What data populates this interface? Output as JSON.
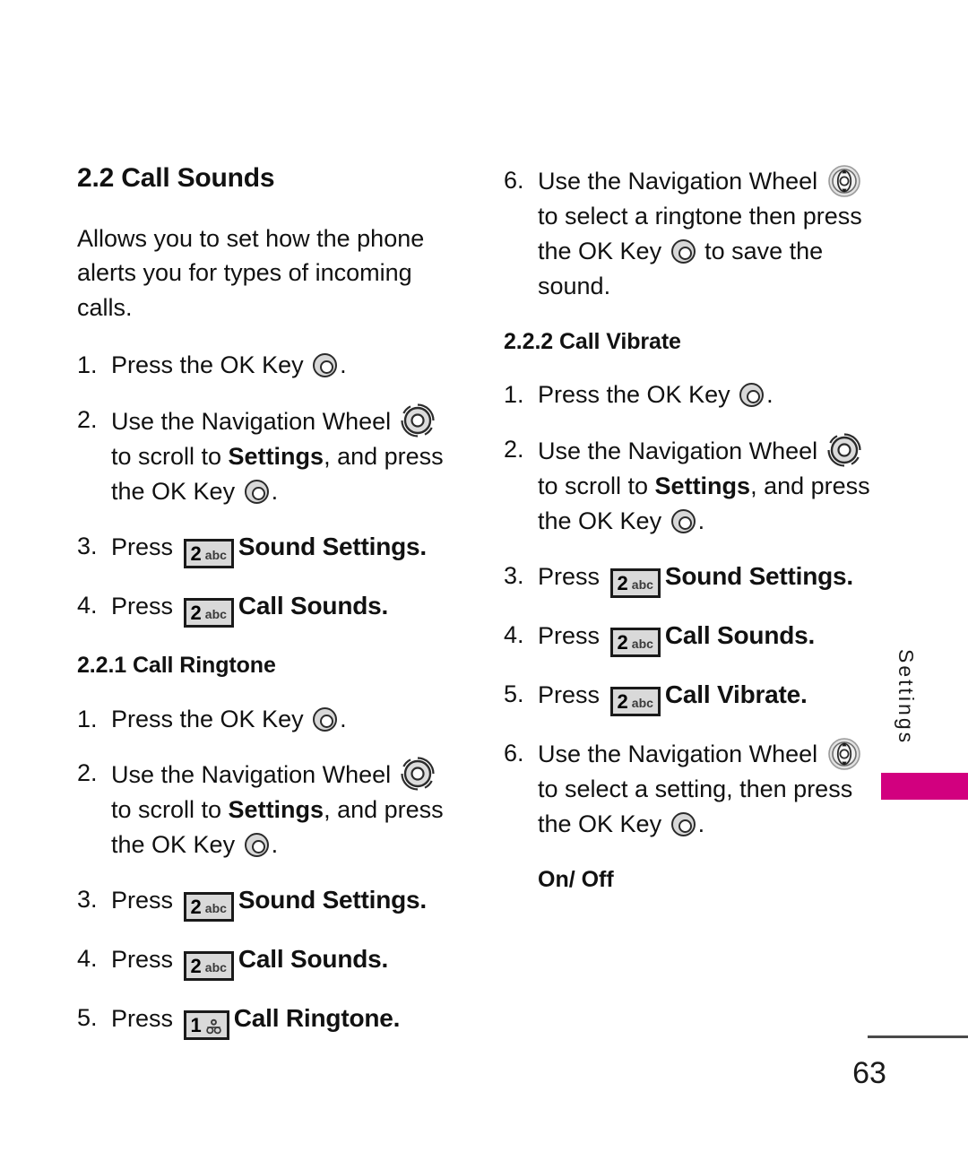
{
  "page": {
    "number": "63",
    "side_tab_label": "Settings",
    "accent_color": "#d2007f"
  },
  "icons": {
    "ok_key": "ok-key-icon",
    "nav_wheel": "navigation-wheel-icon",
    "nav_wheel_arrows": "navigation-wheel-arrows-icon",
    "key_2_abc": "keypad-key-2-abc-icon",
    "key_1_voicemail": "keypad-key-1-voicemail-icon"
  },
  "left_column": {
    "section_heading": "2.2 Call Sounds",
    "intro": "Allows you to set how the phone alerts you for types of incoming calls.",
    "steps": [
      {
        "num": "1.",
        "parts": [
          {
            "t": "text",
            "v": "Press the OK Key "
          },
          {
            "t": "icon",
            "v": "ok-key-icon"
          },
          {
            "t": "text",
            "v": "."
          }
        ]
      },
      {
        "num": "2.",
        "parts": [
          {
            "t": "text",
            "v": "Use the Navigation Wheel "
          },
          {
            "t": "icon",
            "v": "navigation-wheel-icon"
          },
          {
            "t": "text",
            "v": " to scroll to "
          },
          {
            "t": "bold",
            "v": "Settings"
          },
          {
            "t": "text",
            "v": ", and press the OK Key "
          },
          {
            "t": "icon",
            "v": "ok-key-icon"
          },
          {
            "t": "text",
            "v": "."
          }
        ]
      },
      {
        "num": "3.",
        "parts": [
          {
            "t": "text",
            "v": "Press "
          },
          {
            "t": "icon",
            "v": "keypad-key-2-abc-icon"
          },
          {
            "t": "bolditem",
            "v": "Sound Settings."
          }
        ]
      },
      {
        "num": "4.",
        "parts": [
          {
            "t": "text",
            "v": "Press "
          },
          {
            "t": "icon",
            "v": "keypad-key-2-abc-icon"
          },
          {
            "t": "bolditem",
            "v": "Call Sounds."
          }
        ]
      }
    ],
    "subsection_heading": "2.2.1 Call Ringtone",
    "sub_steps": [
      {
        "num": "1.",
        "parts": [
          {
            "t": "text",
            "v": "Press the OK Key "
          },
          {
            "t": "icon",
            "v": "ok-key-icon"
          },
          {
            "t": "text",
            "v": "."
          }
        ]
      },
      {
        "num": "2.",
        "parts": [
          {
            "t": "text",
            "v": "Use the Navigation Wheel "
          },
          {
            "t": "icon",
            "v": "navigation-wheel-icon"
          },
          {
            "t": "text",
            "v": " to scroll to "
          },
          {
            "t": "bold",
            "v": "Settings"
          },
          {
            "t": "text",
            "v": ", and press the OK Key "
          },
          {
            "t": "icon",
            "v": "ok-key-icon"
          },
          {
            "t": "text",
            "v": "."
          }
        ]
      },
      {
        "num": "3.",
        "parts": [
          {
            "t": "text",
            "v": "Press "
          },
          {
            "t": "icon",
            "v": "keypad-key-2-abc-icon"
          },
          {
            "t": "bolditem",
            "v": "Sound Settings."
          }
        ]
      },
      {
        "num": "4.",
        "parts": [
          {
            "t": "text",
            "v": "Press "
          },
          {
            "t": "icon",
            "v": "keypad-key-2-abc-icon"
          },
          {
            "t": "bolditem",
            "v": "Call Sounds."
          }
        ]
      },
      {
        "num": "5.",
        "parts": [
          {
            "t": "text",
            "v": "Press "
          },
          {
            "t": "icon",
            "v": "keypad-key-1-voicemail-icon"
          },
          {
            "t": "bolditem",
            "v": "Call Ringtone."
          }
        ]
      }
    ]
  },
  "right_column": {
    "continued_step": {
      "num": "6.",
      "parts": [
        {
          "t": "text",
          "v": "Use the Navigation Wheel "
        },
        {
          "t": "icon",
          "v": "navigation-wheel-arrows-icon"
        },
        {
          "t": "text",
          "v": " to select a ringtone then press the OK Key "
        },
        {
          "t": "icon",
          "v": "ok-key-icon"
        },
        {
          "t": "text",
          "v": " to save the sound."
        }
      ]
    },
    "subsection_heading": "2.2.2 Call Vibrate",
    "steps": [
      {
        "num": "1.",
        "parts": [
          {
            "t": "text",
            "v": "Press the OK Key "
          },
          {
            "t": "icon",
            "v": "ok-key-icon"
          },
          {
            "t": "text",
            "v": "."
          }
        ]
      },
      {
        "num": "2.",
        "parts": [
          {
            "t": "text",
            "v": "Use the Navigation Wheel "
          },
          {
            "t": "icon",
            "v": "navigation-wheel-icon"
          },
          {
            "t": "text",
            "v": " to scroll to "
          },
          {
            "t": "bold",
            "v": "Settings"
          },
          {
            "t": "text",
            "v": ", and press the OK Key "
          },
          {
            "t": "icon",
            "v": "ok-key-icon"
          },
          {
            "t": "text",
            "v": "."
          }
        ]
      },
      {
        "num": "3.",
        "parts": [
          {
            "t": "text",
            "v": "Press "
          },
          {
            "t": "icon",
            "v": "keypad-key-2-abc-icon"
          },
          {
            "t": "bolditem",
            "v": "Sound Settings."
          }
        ]
      },
      {
        "num": "4.",
        "parts": [
          {
            "t": "text",
            "v": "Press "
          },
          {
            "t": "icon",
            "v": "keypad-key-2-abc-icon"
          },
          {
            "t": "bolditem",
            "v": "Call Sounds."
          }
        ]
      },
      {
        "num": "5.",
        "parts": [
          {
            "t": "text",
            "v": "Press "
          },
          {
            "t": "icon",
            "v": "keypad-key-2-abc-icon"
          },
          {
            "t": "bolditem",
            "v": "Call Vibrate."
          }
        ]
      },
      {
        "num": "6.",
        "parts": [
          {
            "t": "text",
            "v": "Use the Navigation Wheel "
          },
          {
            "t": "icon",
            "v": "navigation-wheel-arrows-icon"
          },
          {
            "t": "text",
            "v": " to select a setting, then press the OK Key "
          },
          {
            "t": "icon",
            "v": "ok-key-icon"
          },
          {
            "t": "text",
            "v": "."
          }
        ]
      }
    ],
    "onoff_heading": "On/ Off"
  }
}
